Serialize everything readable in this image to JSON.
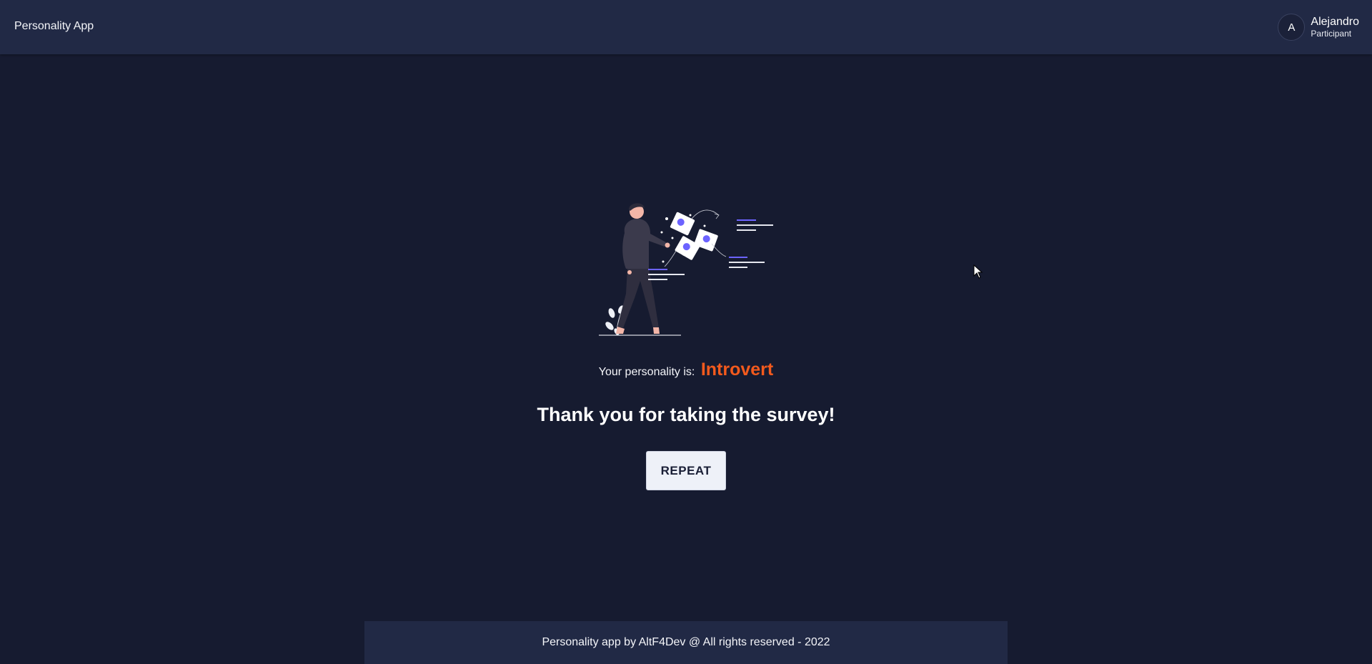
{
  "header": {
    "app_title": "Personality App",
    "user": {
      "initial": "A",
      "name": "Alejandro",
      "role": "Participant"
    }
  },
  "main": {
    "illustration_icon": "person-throwing-documents-illustration",
    "result_label": "Your personality is:",
    "result_value": "Introvert",
    "thanks_message": "Thank you for taking the survey!",
    "repeat_button_label": "REPEAT"
  },
  "footer": {
    "text": "Personality app by AltF4Dev @ All rights reserved - 2022"
  },
  "colors": {
    "background": "#161b30",
    "topbar": "#212945",
    "accent_result": "#f35a1d",
    "illustration_accent": "#6c63ff",
    "button_bg": "#eef1f8"
  }
}
